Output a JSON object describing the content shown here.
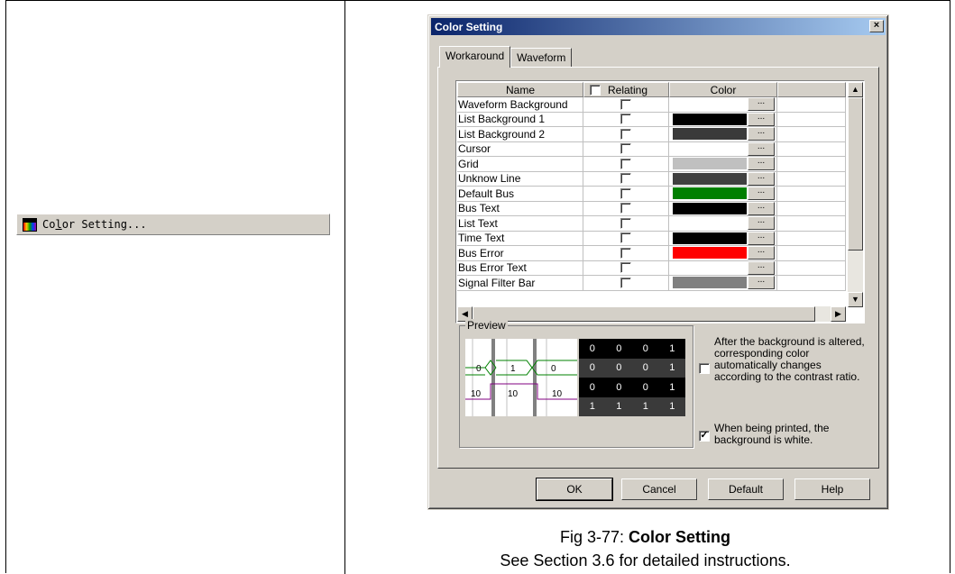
{
  "menu": {
    "icon": "color-palette-icon",
    "label_pre": "Co",
    "label_key": "l",
    "label_post": "or Setting..."
  },
  "dialog": {
    "title": "Color Setting",
    "close_glyph": "×",
    "tabs": [
      "Workaround",
      "Waveform"
    ],
    "columns": {
      "name": "Name",
      "relating": "Relating",
      "color": "Color"
    },
    "rows": [
      {
        "name": "Waveform Background",
        "color": "#ffffff"
      },
      {
        "name": "List Background 1",
        "color": "#000000"
      },
      {
        "name": "List Background 2",
        "color": "#3a3a3a"
      },
      {
        "name": "Cursor",
        "color": "#ffffff"
      },
      {
        "name": "Grid",
        "color": "#c0c0c0"
      },
      {
        "name": "Unknow Line",
        "color": "#404040"
      },
      {
        "name": "Default Bus",
        "color": "#008000"
      },
      {
        "name": "Bus Text",
        "color": "#000000"
      },
      {
        "name": "List Text",
        "color": "#ffffff"
      },
      {
        "name": "Time Text",
        "color": "#000000"
      },
      {
        "name": "Bus Error",
        "color": "#ff0000"
      },
      {
        "name": "Bus Error Text",
        "color": "#ffffff"
      },
      {
        "name": "Signal Filter Bar",
        "color": "#808080"
      }
    ],
    "dots": "...",
    "preview": {
      "label": "Preview",
      "wave_labels": [
        "0",
        "1",
        "0",
        "10",
        "10",
        "10"
      ],
      "list": [
        [
          "0",
          "0",
          "0",
          "1"
        ],
        [
          "0",
          "0",
          "0",
          "1"
        ],
        [
          "0",
          "0",
          "0",
          "1"
        ],
        [
          "1",
          "1",
          "1",
          "1"
        ]
      ]
    },
    "option_contrast": "After the background is altered, corresponding color automatically changes according to the contrast ratio.",
    "option_print": "When being printed, the background is white.",
    "buttons": {
      "ok": "OK",
      "cancel": "Cancel",
      "default": "Default",
      "help": "Help"
    }
  },
  "caption": {
    "prefix": "Fig 3-77: ",
    "title": "Color Setting",
    "note": "See Section 3.6 for detailed instructions."
  }
}
